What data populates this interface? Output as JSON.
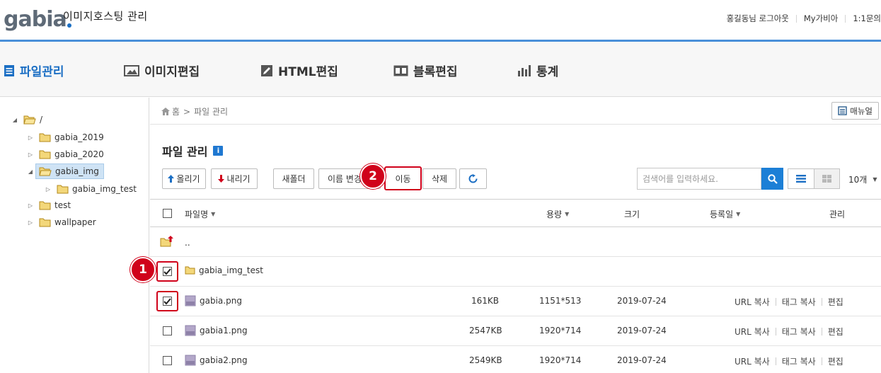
{
  "header": {
    "logo_text": "gabia",
    "app_title": "이미지호스팅 관리",
    "user_logout": "홍길동님 로그아웃",
    "my_gabia": "My가비아",
    "inquiry": "1:1문의"
  },
  "nav": {
    "items": [
      {
        "label": "파일관리",
        "icon": "list-icon",
        "active": true
      },
      {
        "label": "이미지편집",
        "icon": "image-icon"
      },
      {
        "label": "HTML편집",
        "icon": "pencil-icon"
      },
      {
        "label": "블록편집",
        "icon": "block-icon"
      },
      {
        "label": "통계",
        "icon": "bar-chart-icon"
      }
    ]
  },
  "sidebar": {
    "tree": [
      {
        "label": "/",
        "level": 0,
        "expanded": true
      },
      {
        "label": "gabia_2019",
        "level": 1
      },
      {
        "label": "gabia_2020",
        "level": 1
      },
      {
        "label": "gabia_img",
        "level": 1,
        "expanded": true,
        "selected": true
      },
      {
        "label": "gabia_img_test",
        "level": 2
      },
      {
        "label": "test",
        "level": 1
      },
      {
        "label": "wallpaper",
        "level": 1
      }
    ]
  },
  "breadcrumb": {
    "home": "홈",
    "sep": ">",
    "current": "파일 관리"
  },
  "manual_label": "매뉴얼",
  "page_title": "파일 관리",
  "info_label": "i",
  "toolbar": {
    "upload": "올리기",
    "download": "내리기",
    "new_folder": "새폴더",
    "rename": "이름 변경",
    "move": "이동",
    "delete": "삭제",
    "refresh_icon": "refresh-icon",
    "search_placeholder": "검색어를 입력하세요.",
    "per_page": "10개"
  },
  "table": {
    "headers": {
      "name": "파일명",
      "size": "용량",
      "dimensions": "크기",
      "date": "등록일",
      "manage": "관리"
    },
    "parent_row": "..",
    "rows": [
      {
        "type": "folder",
        "name": "gabia_img_test",
        "size": "",
        "dimensions": "",
        "date": "",
        "checked": true
      },
      {
        "type": "png",
        "name": "gabia.png",
        "size": "161KB",
        "dimensions": "1151*513",
        "date": "2019-07-24",
        "checked": true
      },
      {
        "type": "png",
        "name": "gabia1.png",
        "size": "2547KB",
        "dimensions": "1920*714",
        "date": "2019-07-24",
        "checked": false
      },
      {
        "type": "png",
        "name": "gabia2.png",
        "size": "2549KB",
        "dimensions": "1920*714",
        "date": "2019-07-24",
        "checked": false
      }
    ],
    "actions": {
      "url_copy": "URL 복사",
      "tag_copy": "태그 복사",
      "edit": "편집"
    }
  },
  "annotations": {
    "step1": "1",
    "step2": "2"
  },
  "colors": {
    "accent": "#1c6fc4",
    "highlight": "#d0021b",
    "header_line": "#4a90d9"
  }
}
